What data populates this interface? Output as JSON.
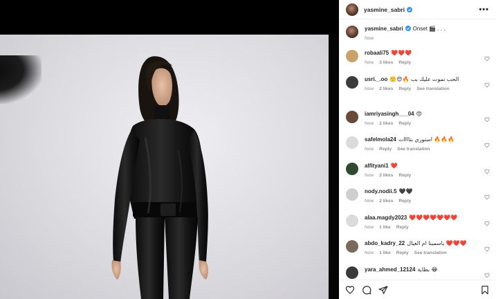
{
  "header": {
    "username": "yasmine_sabri",
    "more_label": "•••"
  },
  "caption": {
    "username": "yasmine_sabri",
    "text": "Onset 🎬 . . .",
    "time": "Now"
  },
  "comments": [
    {
      "username": "robaali75",
      "text": "❤️❤️❤️",
      "time": "Now",
      "likes": "3 likes",
      "reply": "Reply",
      "translate": "",
      "avatar_color": "#c9a16a"
    },
    {
      "username": "usri._.oo",
      "text": "🙂😍🔥 الحب نموت عليك بب",
      "time": "Now",
      "likes": "2 likes",
      "reply": "Reply",
      "translate": "See translation",
      "avatar_color": "#3b3b3b"
    },
    {
      "username": "iamriyasingh___04",
      "text": "😍",
      "time": "Now",
      "likes": "2 likes",
      "reply": "Reply",
      "translate": "",
      "avatar_color": "#6a4a3a"
    },
    {
      "username": "safelmola24",
      "text": "استوري بتاااات 🔥🔥🔥",
      "time": "Now",
      "likes": "",
      "reply": "Reply",
      "translate": "See translation",
      "avatar_color": "#dbdbdb"
    },
    {
      "username": "alfityani1",
      "text": "❤️",
      "time": "Now",
      "likes": "2 likes",
      "reply": "Reply",
      "translate": "",
      "avatar_color": "#2f4a2f"
    },
    {
      "username": "nody.nodii.5",
      "text": "🖤🖤",
      "time": "Now",
      "likes": "2 likes",
      "reply": "Reply",
      "translate": "",
      "avatar_color": "#cfcfcf"
    },
    {
      "username": "alaa.magdy2023",
      "text": "❤️❤️❤️❤️❤️❤️❤️",
      "time": "Now",
      "likes": "1 like",
      "reply": "Reply",
      "translate": "",
      "avatar_color": "#dbdbdb"
    },
    {
      "username": "abdo_kadry_22",
      "text": "ياسمينا ام العيال ❤️❤️❤️",
      "time": "Now",
      "likes": "1 like",
      "reply": "Reply",
      "translate": "See translation",
      "avatar_color": "#7a6a5a"
    },
    {
      "username": "yara_ahmed_12124",
      "text": "بطاية 😂",
      "time": "",
      "likes": "",
      "reply": "",
      "translate": "",
      "avatar_color": "#3a3a3a"
    }
  ],
  "actions": {
    "like_icon": "heart-outline-icon",
    "comment_icon": "comment-icon",
    "share_icon": "paper-plane-icon",
    "save_icon": "bookmark-icon"
  },
  "colors": {
    "verified": "#3897f0",
    "meta_gray": "#8e8e8e",
    "text": "#262626"
  }
}
